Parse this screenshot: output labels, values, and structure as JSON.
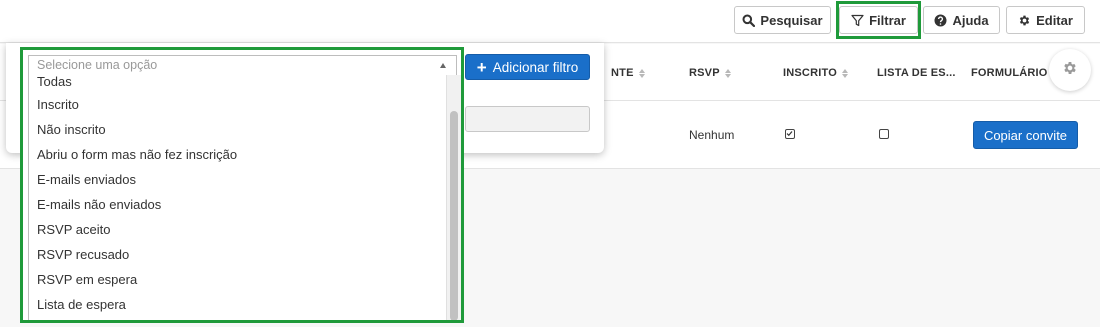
{
  "toolbar": {
    "search_label": "Pesquisar",
    "filter_label": "Filtrar",
    "help_label": "Ajuda",
    "edit_label": "Editar"
  },
  "table": {
    "headers": {
      "partial": "NTE",
      "rsvp": "RSVP",
      "inscrito": "INSCRITO",
      "lista_espera": "LISTA DE ES...",
      "formulario": "FORMULÁRIO"
    },
    "row": {
      "rsvp_value": "Nenhum",
      "inscrito_checked": true,
      "lista_espera_checked": false,
      "copy_button_label": "Copiar convite"
    }
  },
  "filter_popover": {
    "add_filter_label": "Adicionar filtro",
    "select": {
      "placeholder": "Selecione uma opção",
      "options": [
        "Todas",
        "Inscrito",
        "Não inscrito",
        "Abriu o form mas não fez inscrição",
        "E-mails enviados",
        "E-mails não enviados",
        "RSVP aceito",
        "RSVP recusado",
        "RSVP em espera",
        "Lista de espera"
      ]
    }
  },
  "colors": {
    "primary": "#1a6fc9",
    "highlight": "#1f9a3a"
  },
  "icons": [
    "search-icon",
    "filter-icon",
    "help-icon",
    "gear-icon",
    "sort-icon",
    "plus-icon",
    "checkbox-icon"
  ]
}
